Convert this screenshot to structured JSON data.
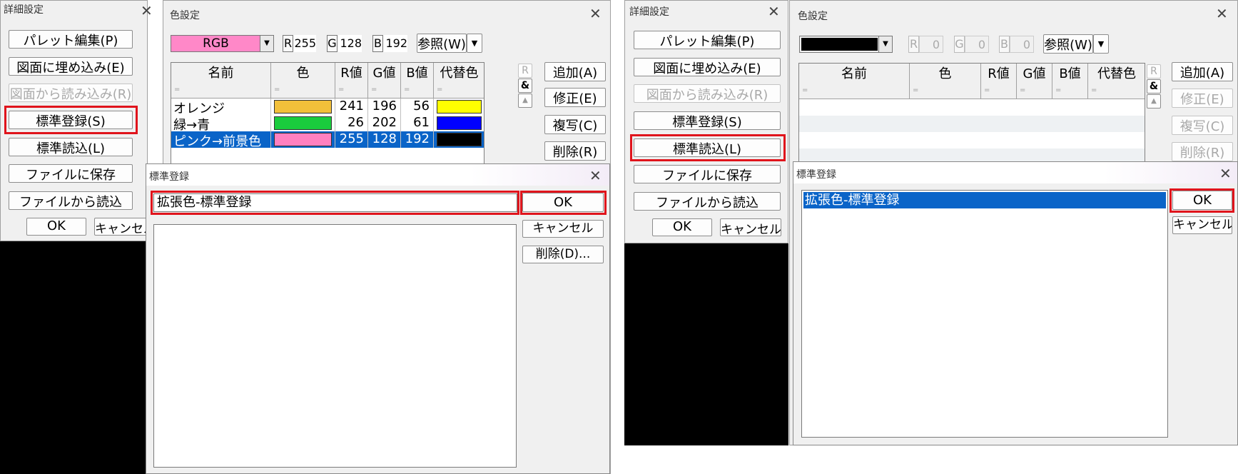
{
  "left": {
    "detail": {
      "title": "詳細設定",
      "buttons": [
        "パレット編集(P)",
        "図面に埋め込み(E)",
        "図面から読み込み(R)",
        "標準登録(S)",
        "標準読込(L)",
        "ファイルに保存",
        "ファイルから読込"
      ],
      "ok": "OK",
      "cancel": "キャンセル"
    },
    "color": {
      "title": "色設定",
      "mode": "RGB",
      "mode_color": "#ff88c8",
      "r_label": "R",
      "r_value": "255",
      "g_label": "G",
      "g_value": "128",
      "b_label": "B",
      "b_value": "192",
      "ref_button": "参照(W)",
      "side_buttons": [
        "追加(A)",
        "修正(E)",
        "複写(C)",
        "削除(R)"
      ],
      "columns": [
        "名前",
        "色",
        "R値",
        "G値",
        "B値",
        "代替色"
      ],
      "filter_marker": "=",
      "flag_r": "R",
      "flag_amp": "&",
      "rows": [
        {
          "name": "オレンジ",
          "color": "#f2c03a",
          "r": "241",
          "g": "196",
          "b": "56",
          "alt": "#ffff00"
        },
        {
          "name": "緑→青",
          "color": "#1acc3d",
          "r": "26",
          "g": "202",
          "b": "61",
          "alt": "#0000ff"
        },
        {
          "name": "ピンク→前景色",
          "color": "#ff80c0",
          "r": "255",
          "g": "128",
          "b": "192",
          "alt": "#000000"
        }
      ]
    },
    "dialog": {
      "title": "標準登録",
      "input_value": "拡張色-標準登録",
      "ok": "OK",
      "cancel": "キャンセル",
      "delete": "削除(D)..."
    }
  },
  "right": {
    "detail": {
      "title": "詳細設定",
      "buttons": [
        "パレット編集(P)",
        "図面に埋め込み(E)",
        "図面から読み込み(R)",
        "標準登録(S)",
        "標準読込(L)",
        "ファイルに保存",
        "ファイルから読込"
      ],
      "ok": "OK",
      "cancel": "キャンセル"
    },
    "color": {
      "title": "色設定",
      "mode_color": "#000000",
      "r_label": "R",
      "r_value": "0",
      "g_label": "G",
      "g_value": "0",
      "b_label": "B",
      "b_value": "0",
      "ref_button": "参照(W)",
      "side_buttons": [
        "追加(A)",
        "修正(E)",
        "複写(C)",
        "削除(R)"
      ],
      "columns": [
        "名前",
        "色",
        "R値",
        "G値",
        "B値",
        "代替色"
      ],
      "filter_marker": "=",
      "flag_r": "R",
      "flag_amp": "&"
    },
    "dialog": {
      "title": "標準登録",
      "list_item": "拡張色-標準登録",
      "ok": "OK",
      "cancel": "キャンセル"
    }
  }
}
